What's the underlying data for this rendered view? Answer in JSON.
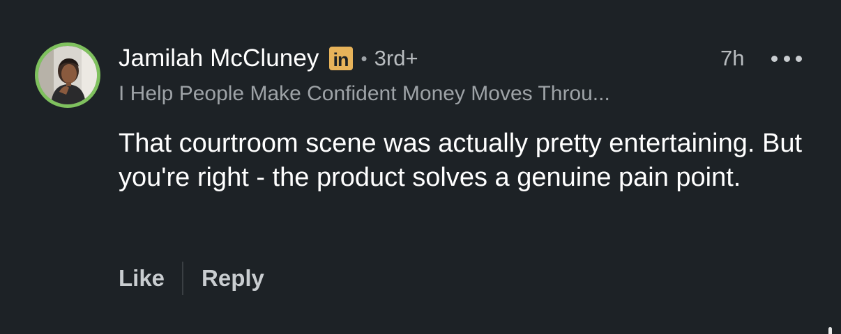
{
  "comment": {
    "author": {
      "name": "Jamilah McCluney",
      "badge": "in",
      "degree": "3rd+",
      "headline": "I Help People Make Confident Money Moves Throu...",
      "ring_color": "#7fc15e",
      "badge_color": "#e7b35a"
    },
    "separator": "•",
    "timestamp": "7h",
    "text": "That courtroom scene was actually pretty entertaining. But you're right - the product solves a genuine pain point.",
    "actions": {
      "like_label": "Like",
      "reply_label": "Reply"
    },
    "icons": {
      "more": "more-horizontal-icon",
      "badge": "linkedin-premium-icon"
    }
  }
}
